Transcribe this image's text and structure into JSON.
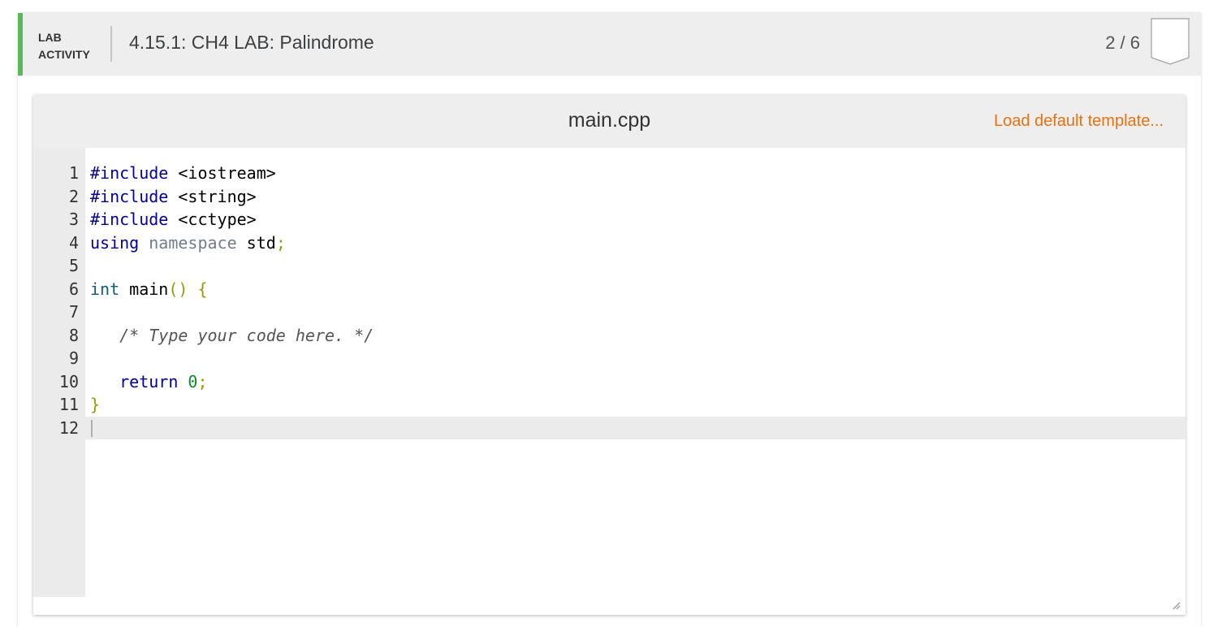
{
  "header": {
    "badge_line1": "LAB",
    "badge_line2": "ACTIVITY",
    "title": "4.15.1: CH4 LAB: Palindrome",
    "progress": "2 / 6",
    "bookmark_icon": "bookmark-icon",
    "accent_color": "#5cb85c"
  },
  "editor": {
    "filename": "main.cpp",
    "load_template_label": "Load default template...",
    "load_template_color": "#e8730e",
    "active_line": 12,
    "lines": [
      {
        "n": "1",
        "tokens": [
          {
            "t": "#include",
            "c": "kw"
          },
          {
            "t": " <iostream>",
            "c": ""
          }
        ]
      },
      {
        "n": "2",
        "tokens": [
          {
            "t": "#include",
            "c": "kw"
          },
          {
            "t": " <string>",
            "c": ""
          }
        ]
      },
      {
        "n": "3",
        "tokens": [
          {
            "t": "#include",
            "c": "kw"
          },
          {
            "t": " <cctype>",
            "c": ""
          }
        ]
      },
      {
        "n": "4",
        "tokens": [
          {
            "t": "using",
            "c": "kw"
          },
          {
            "t": " ",
            "c": ""
          },
          {
            "t": "namespace",
            "c": "ns"
          },
          {
            "t": " std",
            "c": ""
          },
          {
            "t": ";",
            "c": "punct"
          }
        ]
      },
      {
        "n": "5",
        "tokens": []
      },
      {
        "n": "6",
        "tokens": [
          {
            "t": "int",
            "c": "type"
          },
          {
            "t": " main",
            "c": ""
          },
          {
            "t": "()",
            "c": "punct"
          },
          {
            "t": " ",
            "c": ""
          },
          {
            "t": "{",
            "c": "punct"
          }
        ]
      },
      {
        "n": "7",
        "tokens": []
      },
      {
        "n": "8",
        "tokens": [
          {
            "t": "   ",
            "c": ""
          },
          {
            "t": "/* Type your code here. */",
            "c": "comment"
          }
        ]
      },
      {
        "n": "9",
        "tokens": []
      },
      {
        "n": "10",
        "tokens": [
          {
            "t": "   ",
            "c": ""
          },
          {
            "t": "return",
            "c": "kw"
          },
          {
            "t": " ",
            "c": ""
          },
          {
            "t": "0",
            "c": "num"
          },
          {
            "t": ";",
            "c": "punct"
          }
        ]
      },
      {
        "n": "11",
        "tokens": [
          {
            "t": "}",
            "c": "punct"
          }
        ]
      },
      {
        "n": "12",
        "tokens": []
      }
    ]
  }
}
